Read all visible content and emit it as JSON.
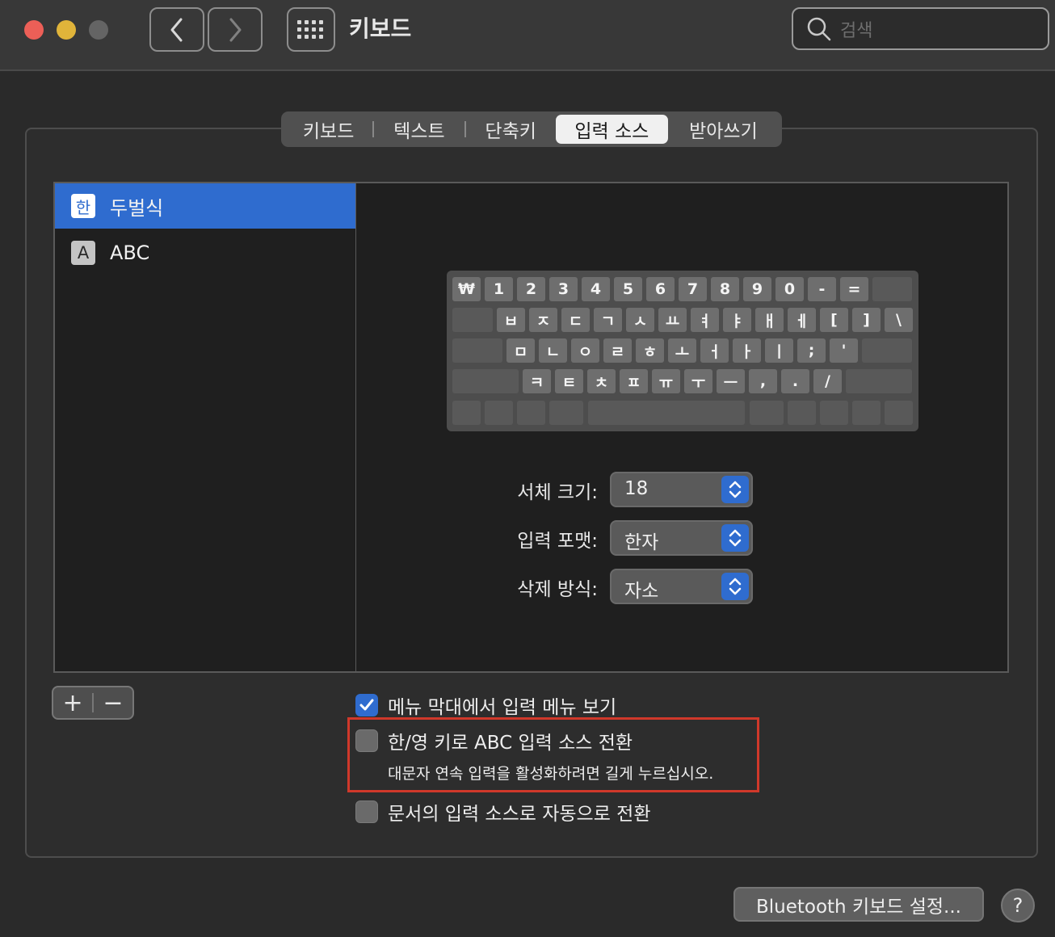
{
  "window": {
    "title": "키보드",
    "search_placeholder": "검색"
  },
  "tabs": [
    "키보드",
    "텍스트",
    "단축키",
    "입력 소스",
    "받아쓰기"
  ],
  "selected_tab": "입력 소스",
  "input_sources": [
    {
      "icon_text": "한",
      "label": "두벌식",
      "selected": true
    },
    {
      "icon_text": "A",
      "label": "ABC",
      "selected": false
    }
  ],
  "keyboard": {
    "row1": [
      "₩",
      "1",
      "2",
      "3",
      "4",
      "5",
      "6",
      "7",
      "8",
      "9",
      "0",
      "-",
      "="
    ],
    "row2": [
      "ㅂ",
      "ㅈ",
      "ㄷ",
      "ㄱ",
      "ㅅ",
      "ㅛ",
      "ㅕ",
      "ㅑ",
      "ㅐ",
      "ㅔ",
      "[",
      "]",
      "\\"
    ],
    "row3": [
      "ㅁ",
      "ㄴ",
      "ㅇ",
      "ㄹ",
      "ㅎ",
      "ㅗ",
      "ㅓ",
      "ㅏ",
      "ㅣ",
      ";",
      "'"
    ],
    "row4": [
      "ㅋ",
      "ㅌ",
      "ㅊ",
      "ㅍ",
      "ㅠ",
      "ㅜ",
      "ㅡ",
      ",",
      ".",
      "/"
    ]
  },
  "settings": {
    "font_size": {
      "label": "서체 크기:",
      "value": "18"
    },
    "input_format": {
      "label": "입력 포맷:",
      "value": "한자"
    },
    "delete_mode": {
      "label": "삭제 방식:",
      "value": "자소"
    }
  },
  "buttons": {
    "add": "+",
    "remove": "−",
    "bluetooth": "Bluetooth 키보드 설정...",
    "help": "?"
  },
  "checkboxes": {
    "show_menu": {
      "label": "메뉴 막대에서 입력 메뉴 보기",
      "checked": true
    },
    "han_yeong": {
      "label": "한/영 키로 ABC 입력 소스 전환",
      "sub": "대문자 연속 입력을 활성화하려면 길게 누르십시오.",
      "checked": false
    },
    "auto_switch": {
      "label": "문서의 입력 소스로 자동으로 전환",
      "checked": false
    }
  },
  "colors": {
    "accent": "#2f6ccf",
    "highlight_box": "#d0382a"
  }
}
